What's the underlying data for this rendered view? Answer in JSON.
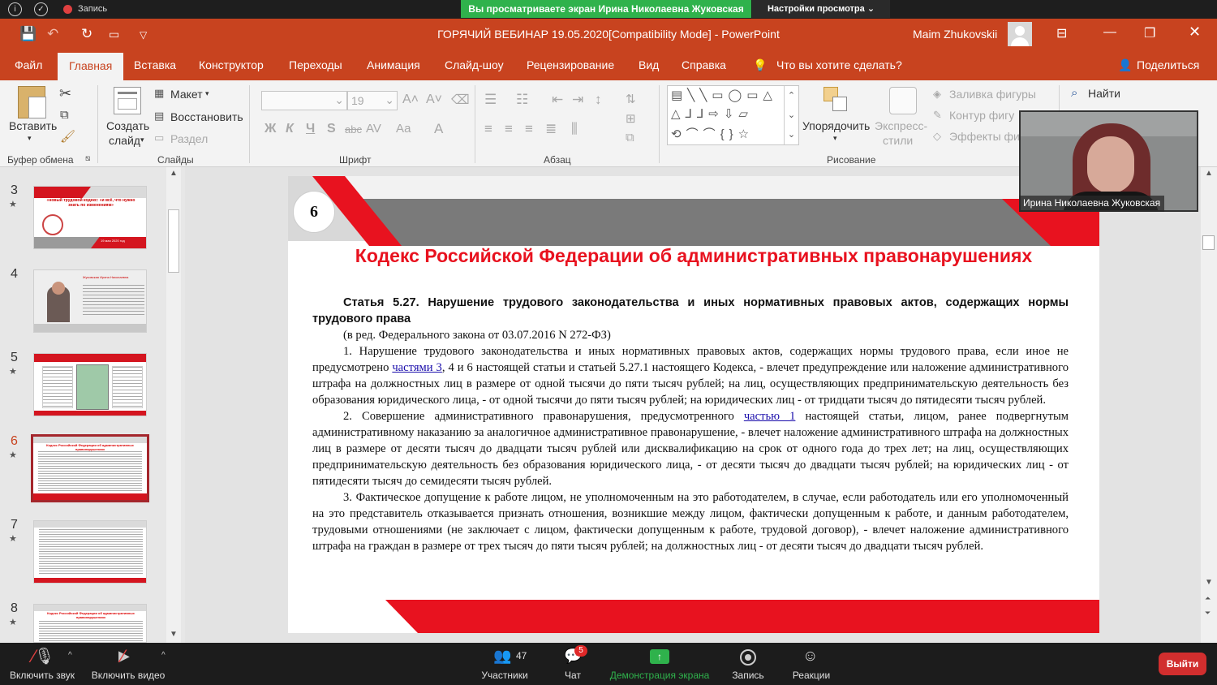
{
  "zoom_top": {
    "recording_label": "Запись",
    "share_banner": "Вы просматриваете экран Ирина Николаевна Жуковская",
    "view_options": "Настройки просмотра ⌄"
  },
  "titlebar": {
    "title": "ГОРЯЧИЙ ВЕБИНАР 19.05.2020[Compatibility Mode]  -  PowerPoint",
    "user": "Maim Zhukovskii"
  },
  "tabs": [
    "Файл",
    "Главная",
    "Вставка",
    "Конструктор",
    "Переходы",
    "Анимация",
    "Слайд-шоу",
    "Рецензирование",
    "Вид",
    "Справка"
  ],
  "tellme": "Что вы хотите сделать?",
  "share_label": "Поделиться",
  "ribbon": {
    "paste": "Вставить",
    "clipboard_group": "Буфер обмена",
    "new_slide_1": "Создать",
    "new_slide_2": "слайд",
    "layout": "Макет",
    "reset": "Восстановить",
    "section": "Раздел",
    "slides_group": "Слайды",
    "font_size": "19",
    "font_group": "Шрифт",
    "font_case": "Аа",
    "paragraph_group": "Абзац",
    "arrange": "Упорядочить",
    "quick_styles_1": "Экспресс-",
    "quick_styles_2": "стили",
    "shape_fill": "Заливка фигуры",
    "shape_outline": "Контур фигу",
    "shape_effects": "Эффекты фиг",
    "drawing_group": "Рисование",
    "find": "Найти"
  },
  "thumbnails": [
    {
      "num": "3",
      "star": true,
      "text": "«новый трудовой кодекс: «и всё, что нужно знать по изменениям»",
      "date": "19 мая 2020 год"
    },
    {
      "num": "4",
      "star": false,
      "text": "Жуковская Ирина Николаевна"
    },
    {
      "num": "5",
      "star": true
    },
    {
      "num": "6",
      "star": true,
      "selected": true,
      "text": "Кодекс Российской Федерации об административных правонарушениях"
    },
    {
      "num": "7",
      "star": true
    },
    {
      "num": "8",
      "star": true,
      "text": "Кодекс Российской Федерации об административных правонарушениях"
    }
  ],
  "slide": {
    "number": "6",
    "title": "Кодекс Российской Федерации об административных правонарушениях",
    "article": "Статья 5.27. Нарушение трудового законодательства и иных нормативных правовых актов, содержащих нормы трудового права",
    "edition": "(в ред. Федерального закона от 03.07.2016 N 272-ФЗ)",
    "p1_a": "1. Нарушение трудового законодательства и иных нормативных правовых актов, содержащих нормы трудового права, если иное не предусмотрено ",
    "p1_link": "частями 3",
    "p1_b": ", 4 и 6 настоящей статьи и статьей 5.27.1 настоящего Кодекса, - влечет предупреждение или наложение административного штрафа на должностных лиц в размере от одной тысячи до пяти тысяч рублей; на лиц, осуществляющих предпринимательскую деятельность без образования юридического лица, - от одной тысячи до пяти тысяч рублей; на юридических лиц - от тридцати тысяч до пятидесяти тысяч рублей.",
    "p2_a": "2. Совершение административного правонарушения, предусмотренного ",
    "p2_link": "частью 1",
    "p2_b": " настоящей статьи, лицом, ранее подвергнутым административному наказанию за аналогичное административное правонарушение, - влечет наложение административного штрафа на должностных лиц в размере от десяти тысяч до двадцати тысяч рублей или дисквалификацию на срок от одного года до трех лет; на лиц, осуществляющих предпринимательскую деятельность без образования юридического лица, - от десяти тысяч до двадцати тысяч рублей; на юридических лиц - от пятидесяти тысяч до семидесяти тысяч рублей.",
    "p3": "3. Фактическое допущение к работе лицом, не уполномоченным на это работодателем, в случае, если работодатель или его уполномоченный на это представитель отказывается признать отношения, возникшие между лицом, фактически допущенным к работе, и данным работодателем, трудовыми отношениями (не заключает с лицом, фактически допущенным к работе, трудовой договор), - влечет наложение административного штрафа на граждан в размере от трех тысяч до пяти тысяч рублей; на должностных лиц - от десяти тысяч до двадцати тысяч рублей."
  },
  "webcam_name": "Ирина Николаевна Жуковская",
  "zoom_bar": {
    "mute": "Включить звук",
    "video": "Включить видео",
    "participants": "Участники",
    "participants_count": "47",
    "chat": "Чат",
    "chat_badge": "5",
    "share": "Демонстрация экрана",
    "record": "Запись",
    "reactions": "Реакции",
    "leave": "Выйти"
  },
  "colors": {
    "accent": "#c8431f",
    "share_green": "#2fb24c",
    "slide_red": "#e8121f",
    "leave_red": "#d12e2e"
  }
}
